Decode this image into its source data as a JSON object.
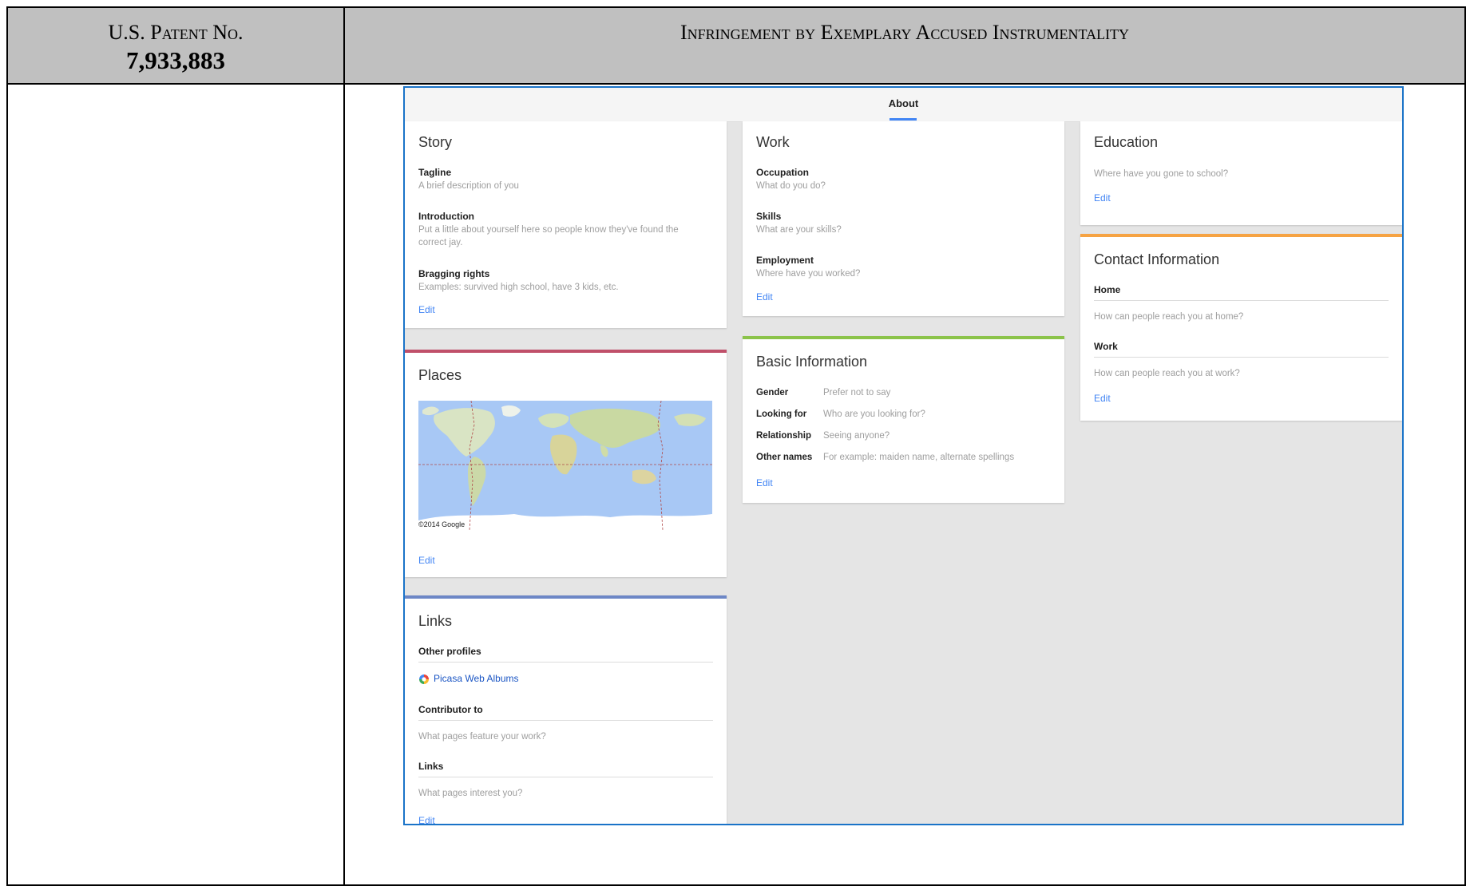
{
  "header": {
    "left_line1": "U.S. Patent No.",
    "left_line2": "7,933,883",
    "right": "Infringement by Exemplary Accused Instrumentality"
  },
  "about": {
    "tab_label": "About",
    "accent_colors": {
      "places": "#c0506a",
      "links": "#6d87c6",
      "basic": "#8bc34a",
      "contact": "#f6a343",
      "link": "#4285f4"
    },
    "story": {
      "title": "Story",
      "tagline_label": "Tagline",
      "tagline_hint": "A brief description of you",
      "intro_label": "Introduction",
      "intro_hint": "Put a little about yourself here so people know they've found the correct jay.",
      "bragging_label": "Bragging rights",
      "bragging_hint": "Examples: survived high school, have 3 kids, etc.",
      "edit": "Edit"
    },
    "work": {
      "title": "Work",
      "occupation_label": "Occupation",
      "occupation_hint": "What do you do?",
      "skills_label": "Skills",
      "skills_hint": "What are your skills?",
      "employment_label": "Employment",
      "employment_hint": "Where have you worked?",
      "edit": "Edit"
    },
    "education": {
      "title": "Education",
      "hint": "Where have you gone to school?",
      "edit": "Edit"
    },
    "contact": {
      "title": "Contact Information",
      "home_label": "Home",
      "home_hint": "How can people reach you at home?",
      "work_label": "Work",
      "work_hint": "How can people reach you at work?",
      "edit": "Edit"
    },
    "places": {
      "title": "Places",
      "map_credit": "©2014 Google",
      "edit": "Edit"
    },
    "basic": {
      "title": "Basic Information",
      "rows": [
        {
          "label": "Gender",
          "value": "Prefer not to say"
        },
        {
          "label": "Looking for",
          "value": "Who are you looking for?"
        },
        {
          "label": "Relationship",
          "value": "Seeing anyone?"
        },
        {
          "label": "Other names",
          "value": "For example: maiden name, alternate spellings"
        }
      ],
      "edit": "Edit"
    },
    "links": {
      "title": "Links",
      "other_profiles_label": "Other profiles",
      "picasa": "Picasa Web Albums",
      "contributor_label": "Contributor to",
      "contributor_hint": "What pages feature your work?",
      "links_label": "Links",
      "links_hint": "What pages interest you?",
      "edit": "Edit"
    }
  }
}
